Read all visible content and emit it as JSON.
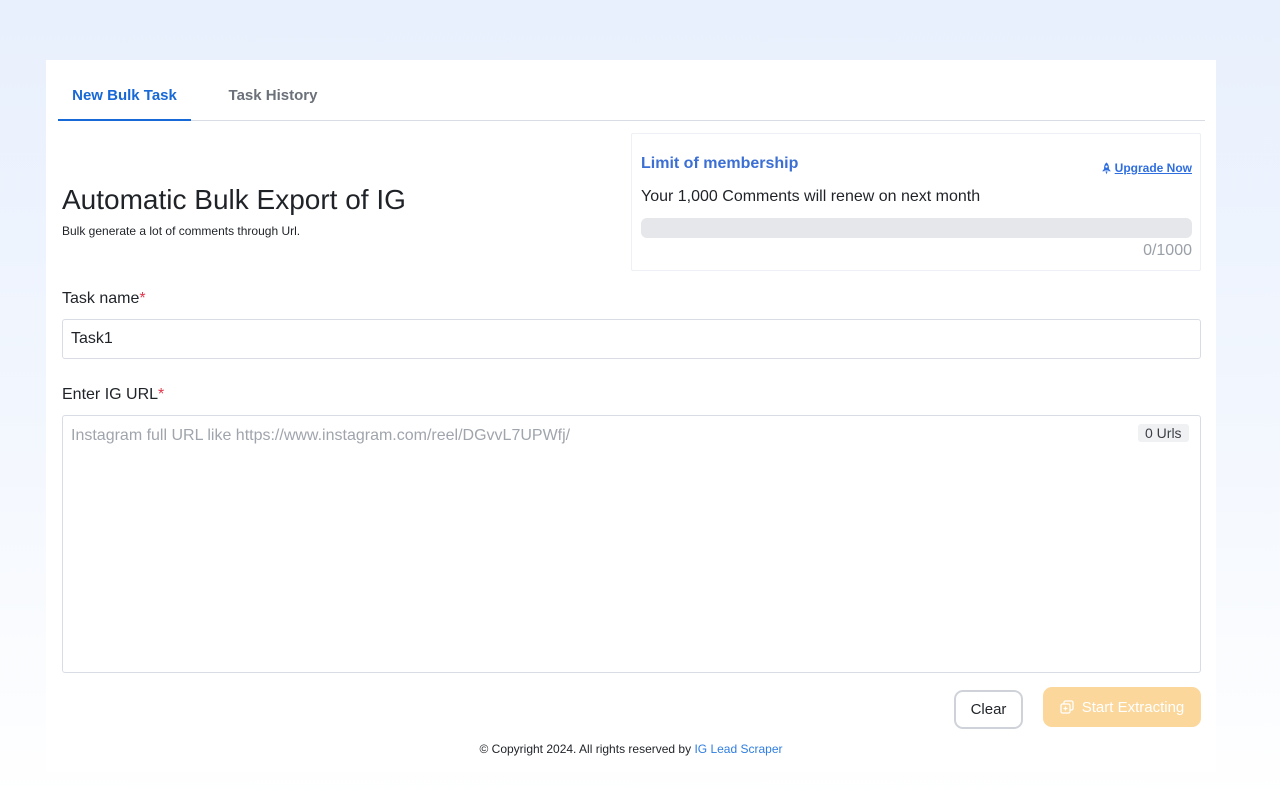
{
  "tabs": [
    {
      "label": "New Bulk Task",
      "active": true
    },
    {
      "label": "Task History",
      "active": false
    }
  ],
  "hero": {
    "title": "Automatic Bulk Export of IG",
    "subtitle": "Bulk generate a lot of comments through Url."
  },
  "membership": {
    "title": "Limit of membership",
    "upgrade_label": "Upgrade Now",
    "upgrade_icon": "rocket-icon",
    "renew_text": "Your 1,000 Comments will renew on next month",
    "used": 0,
    "limit": 1000,
    "progress_fraction": 0,
    "count_text": "0/1000"
  },
  "form": {
    "task_name_label": "Task name",
    "required_mark": "*",
    "task_name_value": "Task1",
    "url_label": "Enter IG URL",
    "url_placeholder": "Instagram full URL like https://www.instagram.com/reel/DGvvL7UPWfj/",
    "url_value": "",
    "url_count": "0 Urls"
  },
  "actions": {
    "clear_label": "Clear",
    "start_label": "Start Extracting",
    "start_icon": "copy-icon"
  },
  "footer": {
    "text": "© Copyright 2024. All rights reserved by ",
    "link_label": "IG Lead Scraper"
  },
  "colors": {
    "accent": "#1669d6",
    "membership_title": "#3b6fd4",
    "required": "#e0384a",
    "start_button": "#fbd79b",
    "footer_link": "#2f7de1"
  }
}
